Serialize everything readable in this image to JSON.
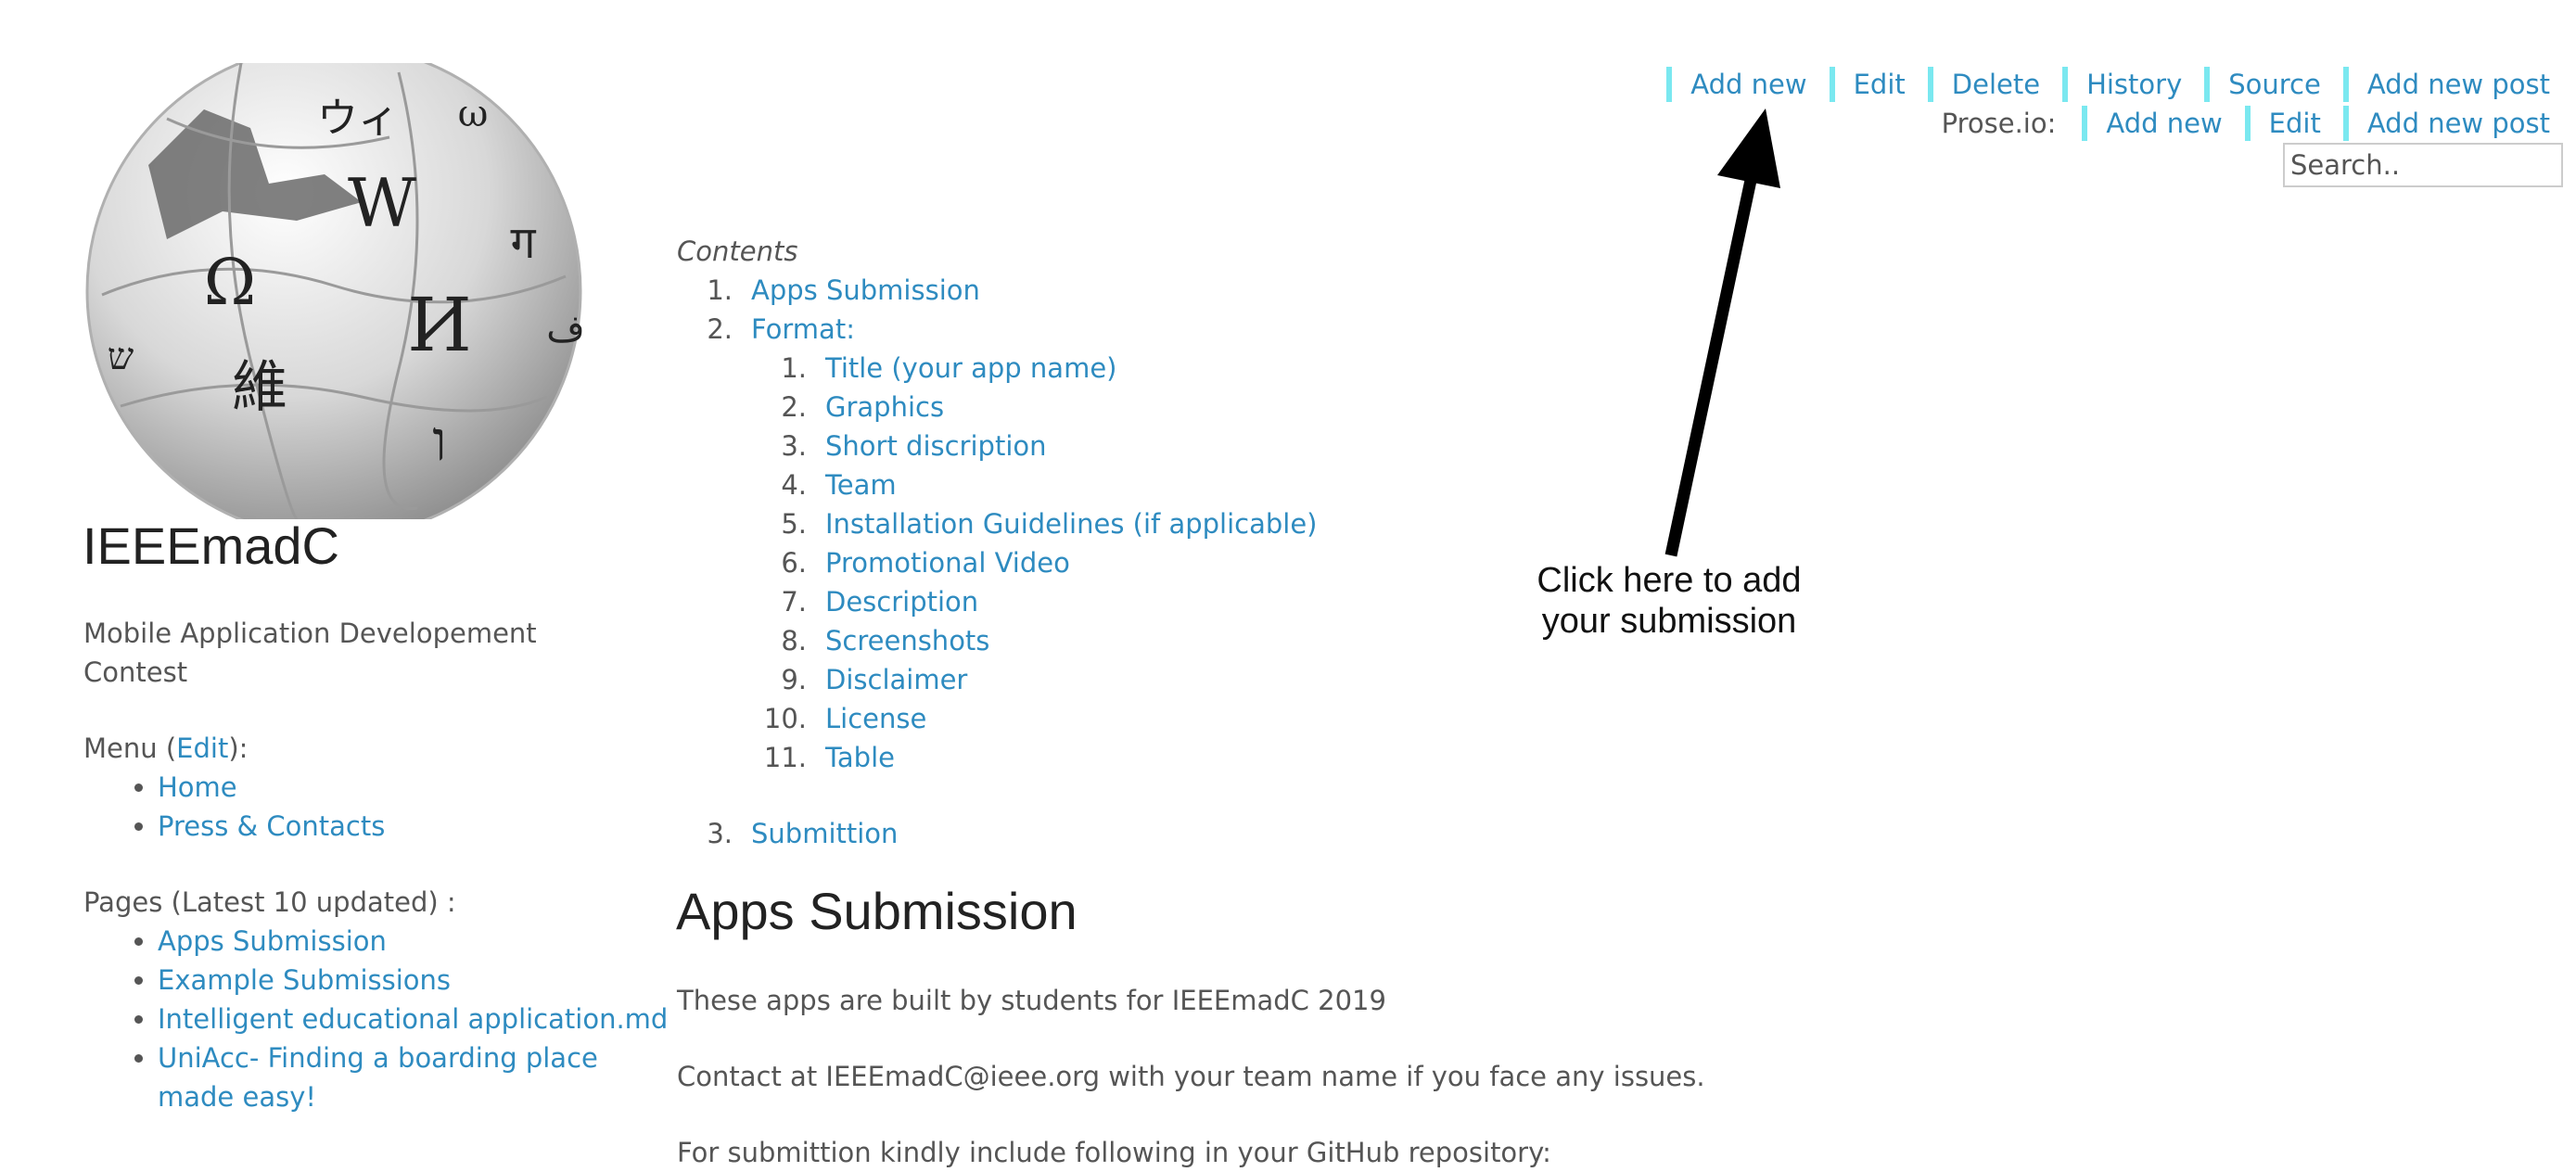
{
  "site": {
    "title": "IEEEmadC",
    "tagline": "Mobile Application Developement Contest"
  },
  "menu": {
    "label_prefix": "Menu (",
    "edit_label": "Edit",
    "label_suffix": "):",
    "items": [
      "Home",
      "Press & Contacts"
    ]
  },
  "pages": {
    "label": "Pages (Latest 10 updated) :",
    "items": [
      "Apps Submission",
      "Example Submissions",
      "Intelligent educational application.md",
      "UniAcc- Finding a boarding place made easy!"
    ]
  },
  "nav": {
    "row1": [
      "Add new",
      "Edit",
      "Delete",
      "History",
      "Source",
      "Add new post"
    ],
    "row2_prefix": "Prose.io:",
    "row2": [
      "Add new",
      "Edit",
      "Add new post"
    ],
    "accent_color": "#7ae8f0"
  },
  "search": {
    "placeholder": "Search.."
  },
  "toc": {
    "label": "Contents",
    "items": [
      {
        "num": "1.",
        "label": "Apps Submission"
      },
      {
        "num": "2.",
        "label": "Format:"
      },
      {
        "num": "3.",
        "label": "Submittion"
      }
    ],
    "sub_items": [
      {
        "num": "1.",
        "label": "Title (your app name)"
      },
      {
        "num": "2.",
        "label": "Graphics"
      },
      {
        "num": "3.",
        "label": "Short discription"
      },
      {
        "num": "4.",
        "label": "Team"
      },
      {
        "num": "5.",
        "label": "Installation Guidelines (if applicable)"
      },
      {
        "num": "6.",
        "label": "Promotional Video"
      },
      {
        "num": "7.",
        "label": "Description"
      },
      {
        "num": "8.",
        "label": "Screenshots"
      },
      {
        "num": "9.",
        "label": "Disclaimer"
      },
      {
        "num": "10.",
        "label": "License"
      },
      {
        "num": "11.",
        "label": "Table"
      }
    ]
  },
  "content": {
    "heading": "Apps Submission",
    "intro": "These apps are built by students for IEEEmadC 2019",
    "contact": "Contact at IEEEmadC@ieee.org with your team name if you face any issues.",
    "cutoff": "For submittion kindly include following in your GitHub repository:"
  },
  "annotation": {
    "line1": "Click here to add",
    "line2": "your submission"
  },
  "logo": {
    "glyphs": [
      "Ω",
      "W",
      "И",
      "維",
      "ウィ",
      "ו",
      "ω",
      "ग",
      "ש",
      "ف"
    ]
  },
  "colors": {
    "link": "#2e8bc0",
    "text": "#555555",
    "heading": "#222222"
  }
}
